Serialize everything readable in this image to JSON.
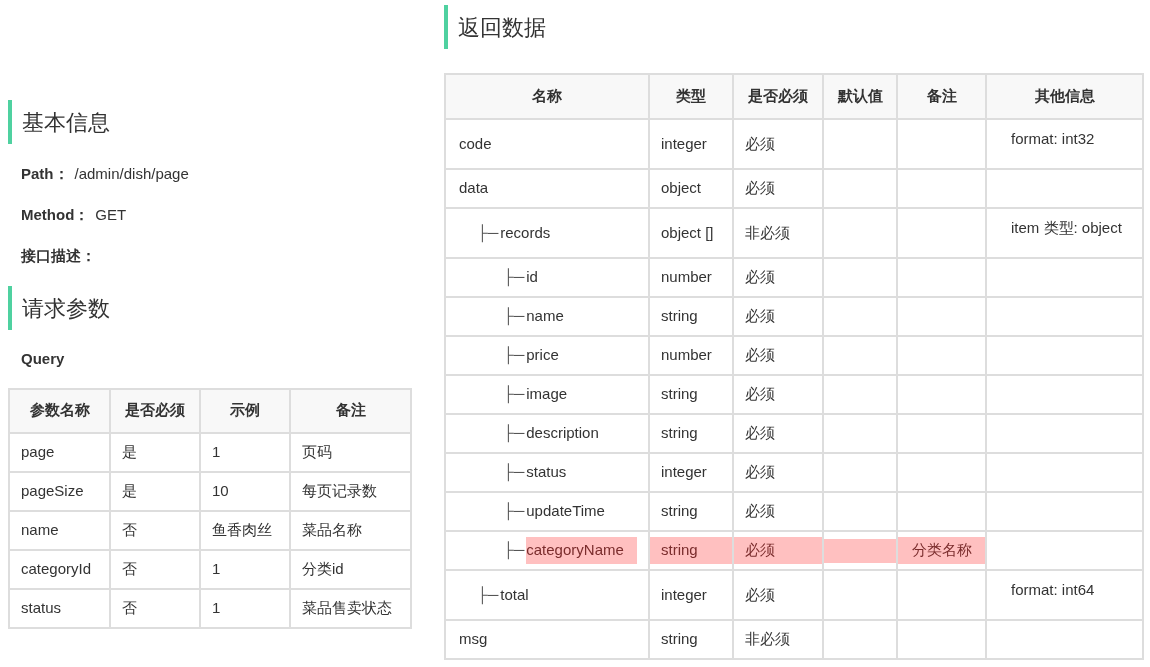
{
  "basic_info": {
    "heading": "基本信息",
    "fields": [
      {
        "label": "Path：",
        "value": "/admin/dish/page"
      },
      {
        "label": "Method：",
        "value": "GET"
      },
      {
        "label": "接口描述："
      }
    ]
  },
  "request_params": {
    "heading": "请求参数",
    "subheading": "Query",
    "table": {
      "columns": [
        "参数名称",
        "是否必须",
        "示例",
        "备注"
      ],
      "rows": [
        [
          "page",
          "是",
          "1",
          "页码"
        ],
        [
          "pageSize",
          "是",
          "10",
          "每页记录数"
        ],
        [
          "name",
          "否",
          "鱼香肉丝",
          "菜品名称"
        ],
        [
          "categoryId",
          "否",
          "1",
          "分类id"
        ],
        [
          "status",
          "否",
          "1",
          "菜品售卖状态"
        ]
      ]
    }
  },
  "response": {
    "heading": "返回数据",
    "table": {
      "columns": [
        "名称",
        "类型",
        "是否必须",
        "默认值",
        "备注",
        "其他信息"
      ],
      "rows": [
        {
          "name": "code",
          "type": "integer",
          "required": "必须",
          "other": "format: int32",
          "highlighted": false
        },
        {
          "name": "data",
          "type": "object",
          "required": "必须",
          "highlighted": false,
          "children": [
            {
              "connector": "├─",
              "name": "records",
              "type": "object []",
              "required": "非必须",
              "other": "item 类型: object",
              "highlighted": false,
              "children": [
                {
                  "connector": "├─",
                  "name": "id",
                  "type": "number",
                  "required": "必须",
                  "highlighted": false
                },
                {
                  "connector": "├─",
                  "name": "name",
                  "type": "string",
                  "required": "必须",
                  "highlighted": false
                },
                {
                  "connector": "├─",
                  "name": "price",
                  "type": "number",
                  "required": "必须",
                  "highlighted": false
                },
                {
                  "connector": "├─",
                  "name": "image",
                  "type": "string",
                  "required": "必须",
                  "highlighted": false
                },
                {
                  "connector": "├─",
                  "name": "description",
                  "type": "string",
                  "required": "必须",
                  "highlighted": false
                },
                {
                  "connector": "├─",
                  "name": "status",
                  "type": "integer",
                  "required": "必须",
                  "highlighted": false
                },
                {
                  "connector": "├─",
                  "name": "updateTime",
                  "type": "string",
                  "required": "必须",
                  "highlighted": false
                },
                {
                  "connector": "├─",
                  "name": "categoryName",
                  "type": "string",
                  "required": "必须",
                  "note": "分类名称",
                  "highlighted": true
                }
              ]
            },
            {
              "connector": "├─",
              "name": "total",
              "type": "integer",
              "required": "必须",
              "other": "format: int64",
              "highlighted": false
            }
          ]
        },
        {
          "name": "msg",
          "type": "string",
          "required": "非必须",
          "highlighted": false
        }
      ]
    }
  }
}
